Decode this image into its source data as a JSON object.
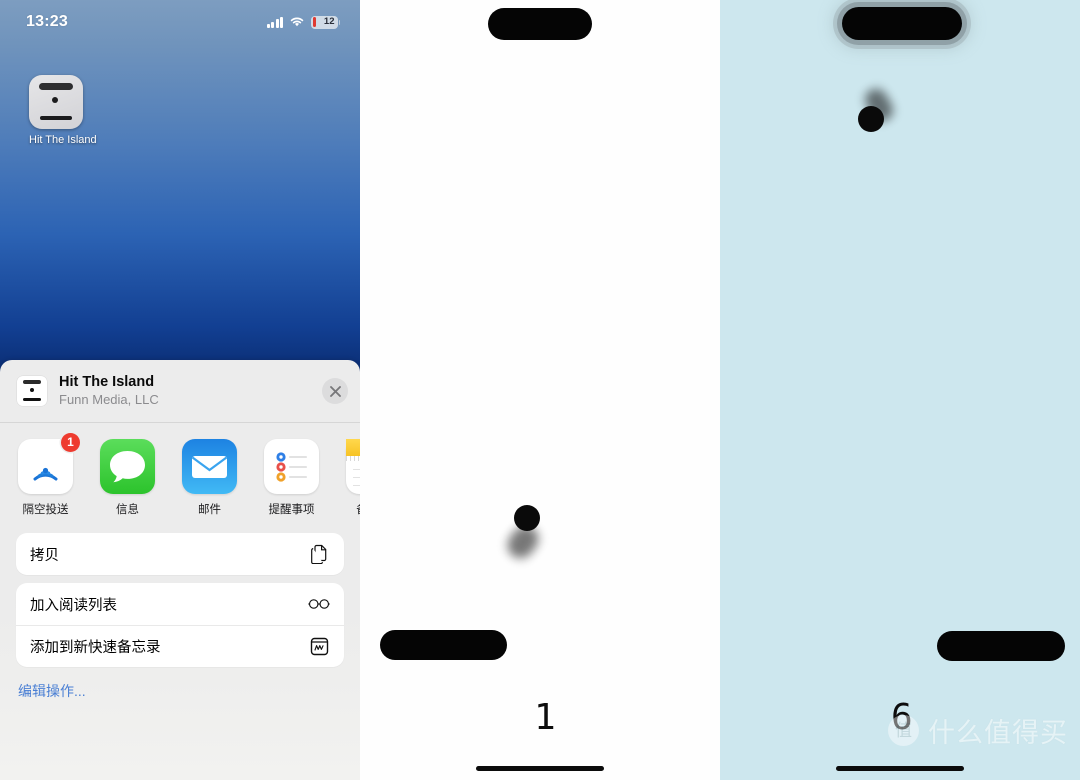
{
  "panels": [
    {
      "kind": "home-screen-share-sheet",
      "status_bar": {
        "time": "13:23",
        "cellular_icon": "cellular-bars-icon",
        "wifi_icon": "wifi-icon",
        "battery_level": "12"
      },
      "home_app": {
        "label": "Hit The Island",
        "icon": "hit-the-island-app-icon"
      },
      "share_sheet": {
        "title": "Hit The Island",
        "subtitle": "Funn Media, LLC",
        "close_icon": "close-icon",
        "apps": [
          {
            "name": "隔空投送",
            "icon": "airdrop-icon",
            "badge": "1"
          },
          {
            "name": "信息",
            "icon": "messages-icon",
            "badge": ""
          },
          {
            "name": "邮件",
            "icon": "mail-icon",
            "badge": ""
          },
          {
            "name": "提醒事项",
            "icon": "reminders-icon",
            "badge": ""
          },
          {
            "name": "备忘录",
            "icon": "notes-icon",
            "badge": ""
          }
        ],
        "actions_primary": [
          {
            "label": "拷贝",
            "icon": "copy-icon"
          }
        ],
        "actions_secondary": [
          {
            "label": "加入阅读列表",
            "icon": "glasses-icon"
          },
          {
            "label": "添加到新快速备忘录",
            "icon": "quick-note-icon"
          }
        ],
        "edit_actions_label": "编辑操作..."
      }
    },
    {
      "kind": "game-white",
      "background_color": "#fefefe",
      "score": "1",
      "island_label": "dynamic-island-target",
      "paddle_label": "player-paddle",
      "ball_label": "game-ball"
    },
    {
      "kind": "game-blue",
      "background_color": "#cde7ee",
      "score": "6",
      "island_label": "dynamic-island-target-glowing",
      "paddle_label": "player-paddle",
      "ball_label": "game-ball",
      "watermark": {
        "mark": "值",
        "text": "什么值得买"
      }
    }
  ]
}
